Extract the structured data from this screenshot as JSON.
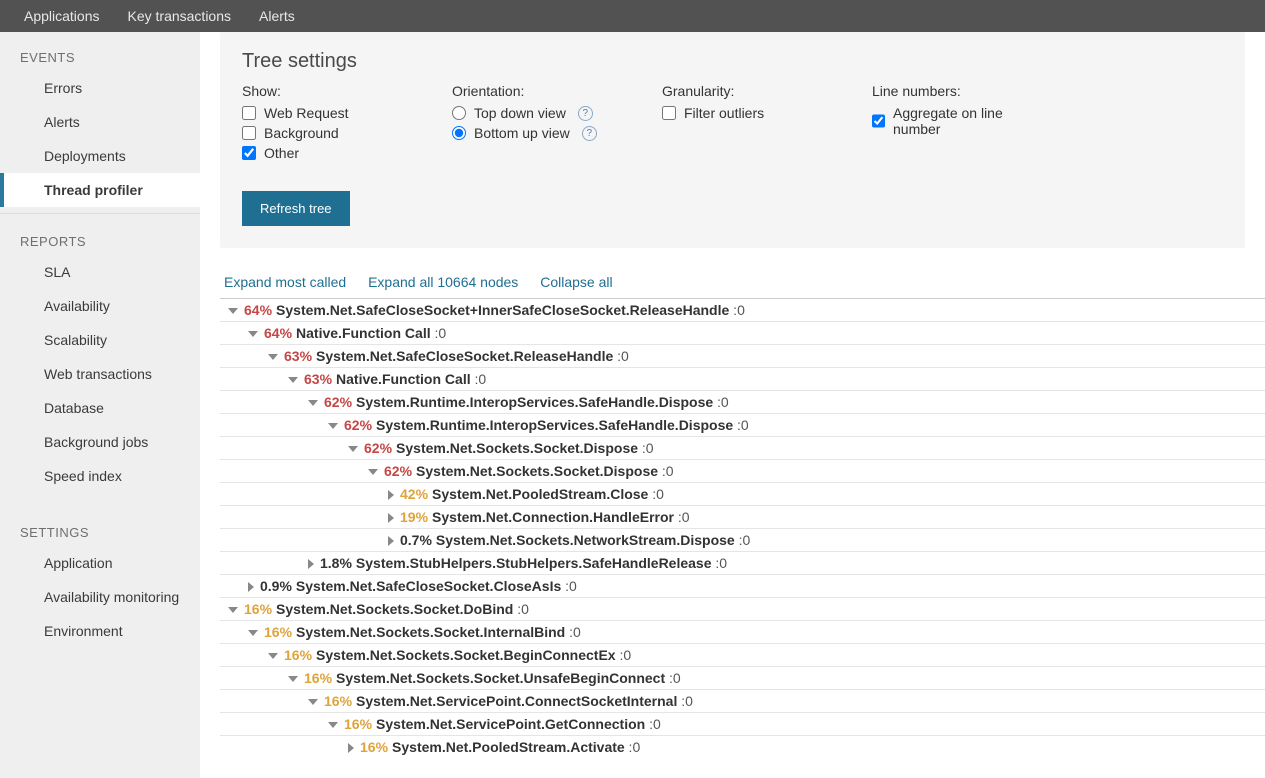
{
  "topnav": {
    "items": [
      "Applications",
      "Key transactions",
      "Alerts"
    ]
  },
  "sidebar": {
    "sections": [
      {
        "title": "EVENTS",
        "items": [
          {
            "label": "Errors",
            "selected": false
          },
          {
            "label": "Alerts",
            "selected": false
          },
          {
            "label": "Deployments",
            "selected": false
          },
          {
            "label": "Thread profiler",
            "selected": true
          }
        ]
      },
      {
        "title": "REPORTS",
        "items": [
          {
            "label": "SLA"
          },
          {
            "label": "Availability"
          },
          {
            "label": "Scalability"
          },
          {
            "label": "Web transactions"
          },
          {
            "label": "Database"
          },
          {
            "label": "Background jobs"
          },
          {
            "label": "Speed index"
          }
        ]
      },
      {
        "title": "SETTINGS",
        "items": [
          {
            "label": "Application"
          },
          {
            "label": "Availability monitoring"
          },
          {
            "label": "Environment"
          }
        ]
      }
    ]
  },
  "settings": {
    "title": "Tree settings",
    "show": {
      "label": "Show:",
      "options": [
        {
          "label": "Web Request",
          "checked": false
        },
        {
          "label": "Background",
          "checked": false
        },
        {
          "label": "Other",
          "checked": true
        }
      ]
    },
    "orientation": {
      "label": "Orientation:",
      "options": [
        {
          "label": "Top down view",
          "checked": false,
          "help": true
        },
        {
          "label": "Bottom up view",
          "checked": true,
          "help": true
        }
      ]
    },
    "granularity": {
      "label": "Granularity:",
      "option": {
        "label": "Filter outliers",
        "checked": false
      }
    },
    "lineNumbers": {
      "label": "Line numbers:",
      "option": {
        "label": "Aggregate on line number",
        "checked": true
      }
    },
    "refresh": "Refresh tree"
  },
  "treeActions": {
    "expandMost": "Expand most called",
    "expandAll": "Expand all 10664 nodes",
    "collapseAll": "Collapse all"
  },
  "tree": [
    {
      "depth": 0,
      "tog": "open",
      "pct": "64%",
      "pctColor": "red",
      "name": "System.Net.SafeCloseSocket+InnerSafeCloseSocket.ReleaseHandle",
      "suffix": " :0"
    },
    {
      "depth": 1,
      "tog": "open",
      "pct": "64%",
      "pctColor": "red",
      "name": "Native.Function Call",
      "suffix": " :0"
    },
    {
      "depth": 2,
      "tog": "open",
      "pct": "63%",
      "pctColor": "red",
      "name": "System.Net.SafeCloseSocket.ReleaseHandle",
      "suffix": " :0"
    },
    {
      "depth": 3,
      "tog": "open",
      "pct": "63%",
      "pctColor": "red",
      "name": "Native.Function Call",
      "suffix": " :0"
    },
    {
      "depth": 4,
      "tog": "open",
      "pct": "62%",
      "pctColor": "red",
      "name": "System.Runtime.InteropServices.SafeHandle.Dispose",
      "suffix": " :0"
    },
    {
      "depth": 5,
      "tog": "open",
      "pct": "62%",
      "pctColor": "red",
      "name": "System.Runtime.InteropServices.SafeHandle.Dispose",
      "suffix": " :0"
    },
    {
      "depth": 6,
      "tog": "open",
      "pct": "62%",
      "pctColor": "red",
      "name": "System.Net.Sockets.Socket.Dispose",
      "suffix": " :0"
    },
    {
      "depth": 7,
      "tog": "open",
      "pct": "62%",
      "pctColor": "red",
      "name": "System.Net.Sockets.Socket.Dispose",
      "suffix": " :0"
    },
    {
      "depth": 8,
      "tog": "closed",
      "pct": "42%",
      "pctColor": "orange",
      "name": "System.Net.PooledStream.Close",
      "suffix": " :0"
    },
    {
      "depth": 8,
      "tog": "closed",
      "pct": "19%",
      "pctColor": "orange",
      "name": "System.Net.Connection.HandleError",
      "suffix": " :0"
    },
    {
      "depth": 8,
      "tog": "closed",
      "pct": "0.7%",
      "pctColor": "dark",
      "name": "System.Net.Sockets.NetworkStream.Dispose",
      "suffix": " :0"
    },
    {
      "depth": 4,
      "tog": "closed",
      "pct": "1.8%",
      "pctColor": "dark",
      "name": "System.StubHelpers.StubHelpers.SafeHandleRelease",
      "suffix": " :0"
    },
    {
      "depth": 1,
      "tog": "closed",
      "pct": "0.9%",
      "pctColor": "dark",
      "name": "System.Net.SafeCloseSocket.CloseAsIs",
      "suffix": " :0"
    },
    {
      "depth": 0,
      "tog": "open",
      "pct": "16%",
      "pctColor": "orange",
      "name": "System.Net.Sockets.Socket.DoBind",
      "suffix": " :0"
    },
    {
      "depth": 1,
      "tog": "open",
      "pct": "16%",
      "pctColor": "orange",
      "name": "System.Net.Sockets.Socket.InternalBind",
      "suffix": " :0"
    },
    {
      "depth": 2,
      "tog": "open",
      "pct": "16%",
      "pctColor": "orange",
      "name": "System.Net.Sockets.Socket.BeginConnectEx",
      "suffix": " :0"
    },
    {
      "depth": 3,
      "tog": "open",
      "pct": "16%",
      "pctColor": "orange",
      "name": "System.Net.Sockets.Socket.UnsafeBeginConnect",
      "suffix": " :0"
    },
    {
      "depth": 4,
      "tog": "open",
      "pct": "16%",
      "pctColor": "orange",
      "name": "System.Net.ServicePoint.ConnectSocketInternal",
      "suffix": " :0"
    },
    {
      "depth": 5,
      "tog": "open",
      "pct": "16%",
      "pctColor": "orange",
      "name": "System.Net.ServicePoint.GetConnection",
      "suffix": " :0"
    },
    {
      "depth": 6,
      "tog": "closed",
      "pct": "16%",
      "pctColor": "orange",
      "name": "System.Net.PooledStream.Activate",
      "suffix": " :0"
    }
  ]
}
